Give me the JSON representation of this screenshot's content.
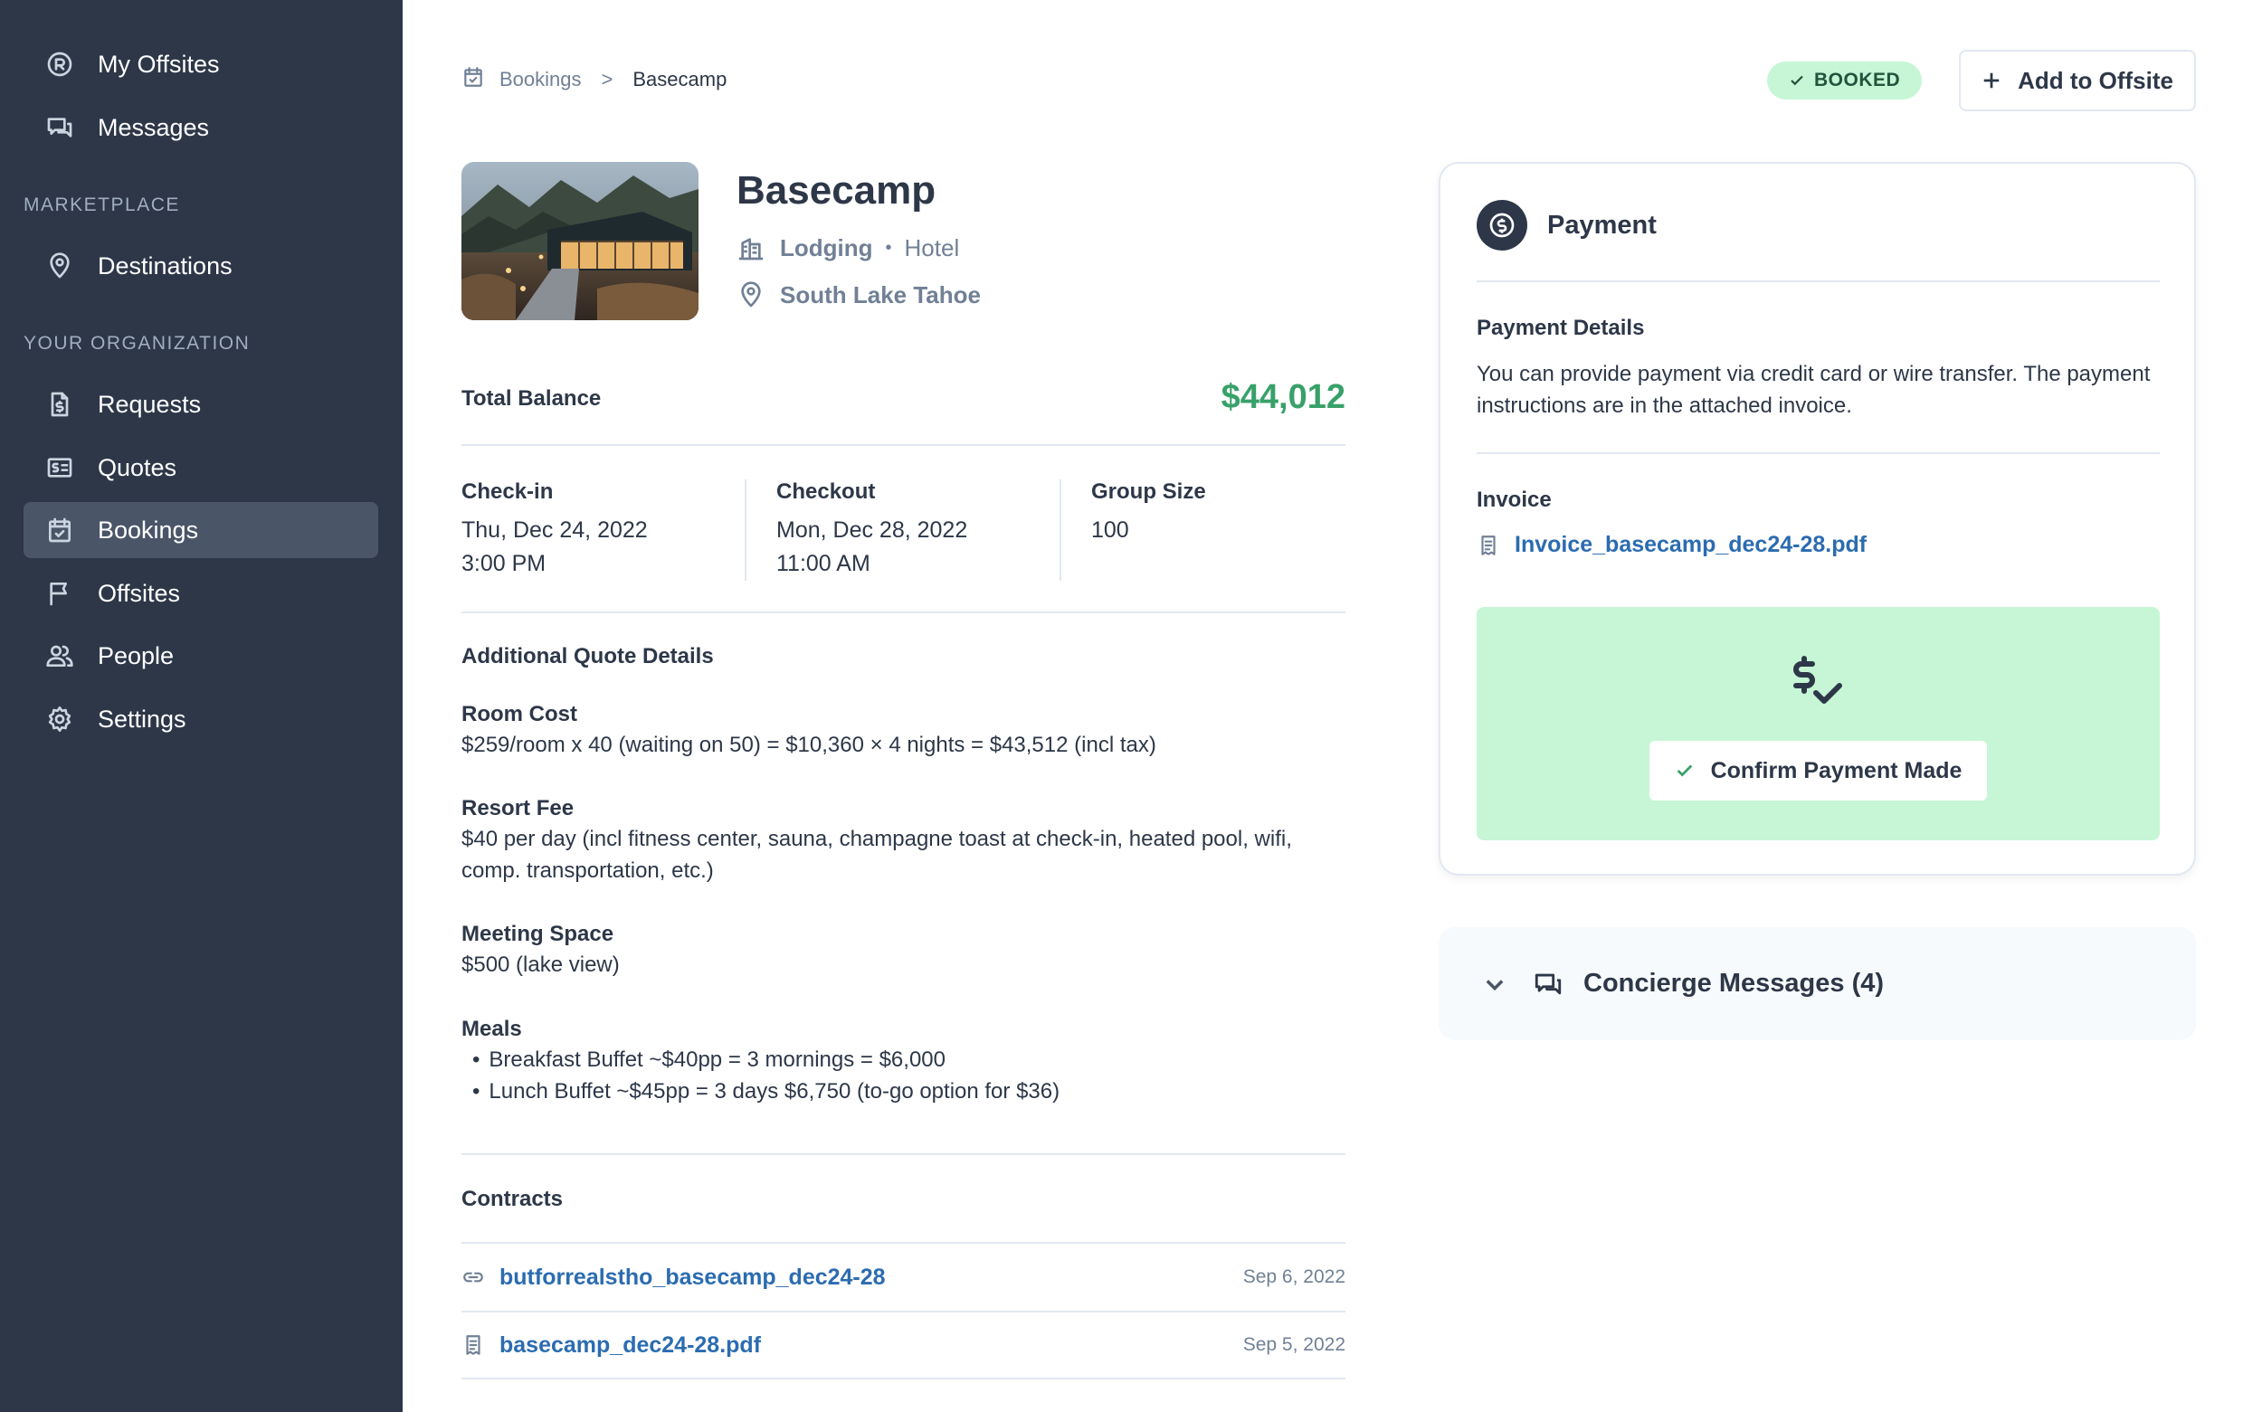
{
  "sidebar": {
    "top_items": [
      {
        "label": "My Offsites",
        "icon": "offsite-logo-icon"
      },
      {
        "label": "Messages",
        "icon": "messages-icon"
      }
    ],
    "marketplace_heading": "MARKETPLACE",
    "marketplace_items": [
      {
        "label": "Destinations",
        "icon": "map-pin-icon"
      }
    ],
    "org_heading": "YOUR ORGANIZATION",
    "org_items": [
      {
        "label": "Requests",
        "icon": "document-dollar-icon"
      },
      {
        "label": "Quotes",
        "icon": "bill-icon"
      },
      {
        "label": "Bookings",
        "icon": "calendar-check-icon",
        "active": true
      },
      {
        "label": "Offsites",
        "icon": "flag-icon"
      },
      {
        "label": "People",
        "icon": "people-icon"
      },
      {
        "label": "Settings",
        "icon": "gear-icon"
      }
    ]
  },
  "breadcrumb": {
    "parent": "Bookings",
    "separator": ">",
    "current": "Basecamp"
  },
  "header": {
    "status": "BOOKED",
    "status_color": "#c6f6d5",
    "add_button": "Add to Offsite"
  },
  "venue": {
    "name": "Basecamp",
    "category": "Lodging",
    "type": "Hotel",
    "location": "South Lake Tahoe"
  },
  "balance": {
    "label": "Total Balance",
    "value": "$44,012",
    "value_color": "#38a169"
  },
  "stats": {
    "checkin": {
      "label": "Check-in",
      "date": "Thu, Dec 24, 2022",
      "time": "3:00 PM"
    },
    "checkout": {
      "label": "Checkout",
      "date": "Mon, Dec 28, 2022",
      "time": "11:00 AM"
    },
    "group": {
      "label": "Group Size",
      "value": "100"
    }
  },
  "quote_details": {
    "title": "Additional Quote Details",
    "room_cost": {
      "label": "Room Cost",
      "text": "$259/room x 40 (waiting on 50) = $10,360 × 4 nights = $43,512 (incl tax)"
    },
    "resort_fee": {
      "label": "Resort Fee",
      "text": "$40 per day (incl fitness center, sauna, champagne toast at check-in, heated pool, wifi, comp. transportation, etc.)"
    },
    "meeting_space": {
      "label": "Meeting Space",
      "text": "$500 (lake view)"
    },
    "meals": {
      "label": "Meals",
      "items": [
        "Breakfast Buffet ~$40pp = 3 mornings = $6,000",
        "Lunch Buffet ~$45pp = 3 days $6,750 (to-go option for $36)"
      ]
    }
  },
  "contracts": {
    "title": "Contracts",
    "rows": [
      {
        "name": "butforrealstho_basecamp_dec24-28",
        "date": "Sep 6, 2022",
        "icon": "link-icon"
      },
      {
        "name": "basecamp_dec24-28.pdf",
        "date": "Sep 5, 2022",
        "icon": "receipt-icon"
      }
    ]
  },
  "payment": {
    "title": "Payment",
    "details_label": "Payment Details",
    "details_text": "You can provide payment via credit card or wire transfer. The payment instructions are in the attached invoice.",
    "invoice_label": "Invoice",
    "invoice_file": "Invoice_basecamp_dec24-28.pdf",
    "confirm_button": "Confirm Payment Made",
    "panel_color": "#c6f6d5"
  },
  "concierge": {
    "title": "Concierge Messages (4)"
  },
  "colors": {
    "sidebar_bg": "#2d3748",
    "link": "#2b6cb0"
  }
}
